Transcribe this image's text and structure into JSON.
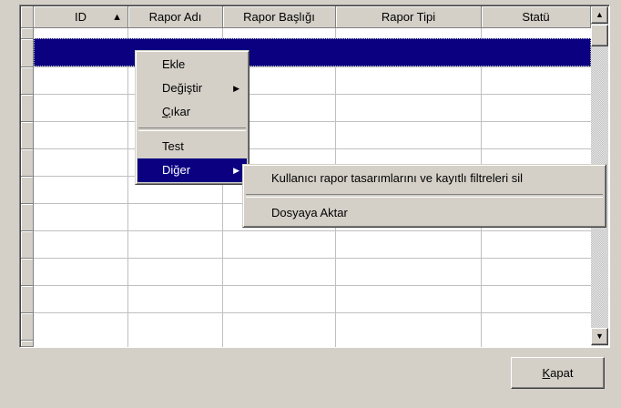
{
  "grid": {
    "columns": [
      {
        "label": "ID",
        "sorted": "ascending",
        "sort_glyph": "▲"
      },
      {
        "label": "Rapor Adı"
      },
      {
        "label": "Rapor Başlığı"
      },
      {
        "label": "Rapor Tipi"
      },
      {
        "label": "Statü"
      }
    ],
    "rows": [],
    "selected_row_index": 0
  },
  "scrollbar": {
    "up_glyph": "▲",
    "down_glyph": "▼"
  },
  "context_menu": {
    "items": [
      {
        "label": "Ekle"
      },
      {
        "label": "Değiştir",
        "submenu_glyph": "▶"
      },
      {
        "label": "Çıkar",
        "mnemonic": "Ç",
        "rest": "ıkar"
      },
      {
        "label": "Test"
      },
      {
        "label": "Diğer",
        "submenu_glyph": "▶",
        "active": true
      }
    ]
  },
  "submenu": {
    "items": [
      {
        "label": "Kullanıcı rapor tasarımlarını ve kayıtlı filtreleri sil"
      },
      {
        "label": "Dosyaya Aktar"
      }
    ]
  },
  "close_button": {
    "label": "Kapat",
    "mnemonic": "K",
    "rest": "apat"
  },
  "colors": {
    "selection": "#0a0080",
    "face": "#d4d0c8",
    "grid_line": "#c0c0c0"
  }
}
